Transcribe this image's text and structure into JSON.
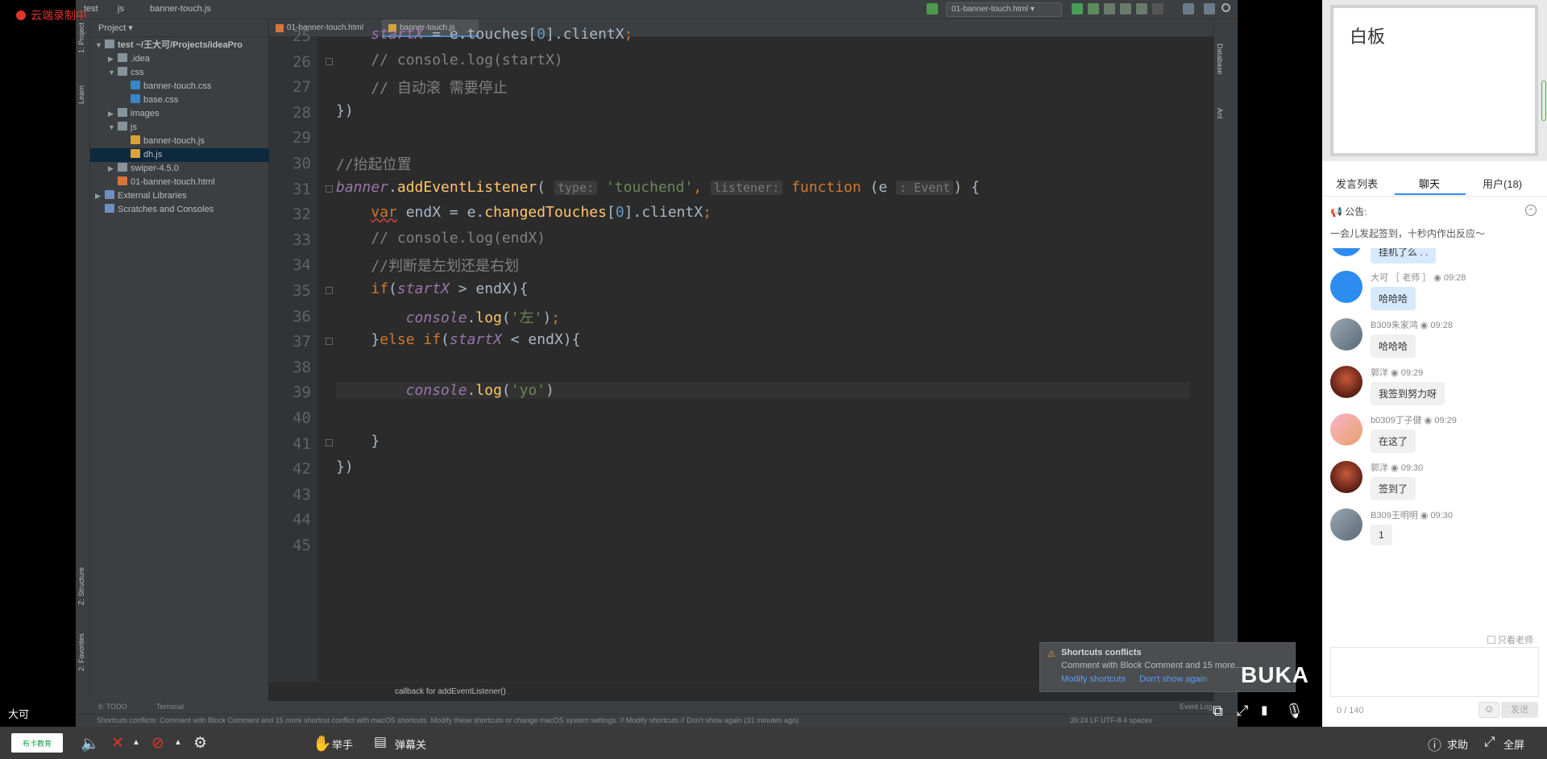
{
  "recording": {
    "label": "云端录制中"
  },
  "speaker": {
    "name": "大可"
  },
  "ide": {
    "breadcrumbs": [
      "test",
      "js",
      "banner-touch.js"
    ],
    "run_config": "01-banner-touch.html ▾",
    "project_label": "Project ▾",
    "tree": [
      {
        "label": "test  ~/王大可/Projects/ideaPro",
        "indent": 0,
        "arrow": "▼",
        "icon": "folder",
        "bold": true
      },
      {
        "label": ".idea",
        "indent": 1,
        "arrow": "▶",
        "icon": "folder"
      },
      {
        "label": "css",
        "indent": 1,
        "arrow": "▼",
        "icon": "folder"
      },
      {
        "label": "banner-touch.css",
        "indent": 2,
        "arrow": "",
        "icon": "css"
      },
      {
        "label": "base.css",
        "indent": 2,
        "arrow": "",
        "icon": "css"
      },
      {
        "label": "images",
        "indent": 1,
        "arrow": "▶",
        "icon": "folder"
      },
      {
        "label": "js",
        "indent": 1,
        "arrow": "▼",
        "icon": "folder"
      },
      {
        "label": "banner-touch.js",
        "indent": 2,
        "arrow": "",
        "icon": "js"
      },
      {
        "label": "dh.js",
        "indent": 2,
        "arrow": "",
        "icon": "js",
        "selected": true
      },
      {
        "label": "swiper-4.5.0",
        "indent": 1,
        "arrow": "▶",
        "icon": "folder"
      },
      {
        "label": "01-banner-touch.html",
        "indent": 1,
        "arrow": "",
        "icon": "html"
      },
      {
        "label": "External Libraries",
        "indent": 0,
        "arrow": "▶",
        "icon": "lib"
      },
      {
        "label": "Scratches and Consoles",
        "indent": 0,
        "arrow": "",
        "icon": "lib"
      }
    ],
    "tabs": [
      {
        "label": "01-banner-touch.html",
        "icon": "html",
        "active": false
      },
      {
        "label": "banner-touch.js",
        "icon": "js",
        "active": true
      }
    ],
    "left_vtabs": [
      "1: Project",
      "Learn",
      "Z: Structure",
      "2: Favorites"
    ],
    "right_vtabs": [
      "Database",
      "Ant"
    ],
    "line_numbers": [
      "25",
      "26",
      "27",
      "28",
      "29",
      "30",
      "31",
      "32",
      "33",
      "34",
      "35",
      "36",
      "37",
      "38",
      "39",
      "40",
      "41",
      "42",
      "43",
      "44",
      "45"
    ],
    "code_breadcrumb": "callback for addEventListener()",
    "bottom_tools": [
      "6: TODO",
      "Terminal",
      "Event Log"
    ],
    "status_text": "Shortcuts conflicts: Comment with Block Comment and 15 more shortcut conflict with macOS shortcuts. Modify these shortcuts or change macOS system settings. // Modify shortcuts // Don't show again (31 minutes ago)",
    "status_right": "39:24   LF   UTF-8   4 spaces",
    "notification": {
      "title": "Shortcuts conflicts",
      "body": "Comment with Block Comment and 15 more...",
      "link1": "Modify shortcuts",
      "link2": "Don't show again"
    }
  },
  "panel": {
    "whiteboard_title": "白板",
    "tabs": [
      "发言列表",
      "聊天",
      "用户(18)"
    ],
    "notice_label": "公告:",
    "notice_text": "一会儿发起签到，十秒内作出反应～",
    "messages": [
      {
        "name": "",
        "time": "",
        "text": "挂机了么 . .",
        "avatar": "blue",
        "bubble": "blue"
      },
      {
        "name": "大可 ［ 老师 ］",
        "time": "09:28",
        "text": "哈哈哈",
        "avatar": "blue",
        "bubble": "blue"
      },
      {
        "name": "B309朱家鸿",
        "time": "09:28",
        "text": "哈哈哈",
        "avatar": "sky",
        "bubble": "gray"
      },
      {
        "name": "郭洋",
        "time": "09:29",
        "text": "我签到努力呀",
        "avatar": "red",
        "bubble": "gray"
      },
      {
        "name": "b0309丁子健",
        "time": "09:29",
        "text": "在这了",
        "avatar": "pink",
        "bubble": "gray"
      },
      {
        "name": "郭洋",
        "time": "09:30",
        "text": "签到了",
        "avatar": "red",
        "bubble": "gray"
      },
      {
        "name": "B309王明明",
        "time": "09:30",
        "text": "1",
        "avatar": "sky",
        "bubble": "gray"
      }
    ],
    "only_teacher": "只看老师",
    "counter": "0 / 140",
    "send": "发送"
  },
  "buka_logo": "BUKA",
  "bottom_bar": {
    "brand": "布卡教育",
    "hand_label": "举手",
    "danmaku_label": "弹幕关",
    "help_label": "求助",
    "fullscreen_label": "全屏"
  },
  "colors": {
    "keyword": "#cc7832",
    "string": "#6a8759",
    "comment": "#808080",
    "function": "#ffc66d",
    "accent": "#2d8cf0",
    "record": "#e0352b"
  }
}
